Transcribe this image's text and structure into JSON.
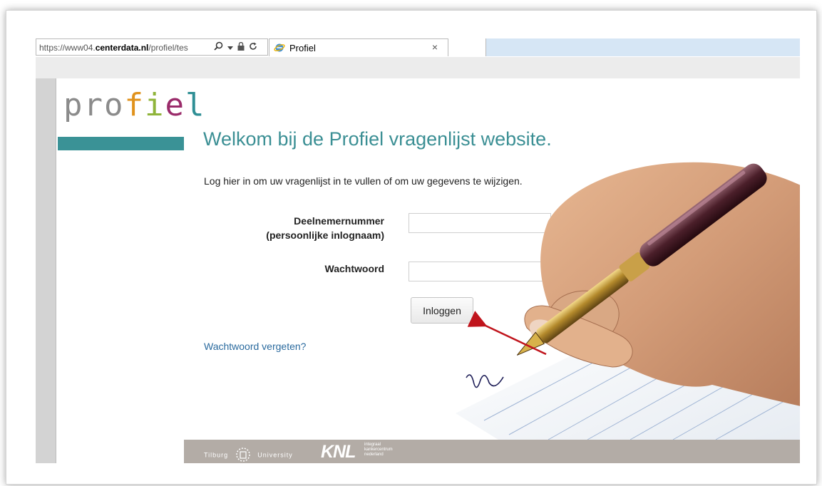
{
  "browser": {
    "url_prefix": "https://www04.",
    "url_domain": "centerdata.nl",
    "url_path": "/profiel/tes",
    "tab_title": "Profiel",
    "tab_close": "×"
  },
  "logo": {
    "pro": "pro",
    "f": "f",
    "i": "i",
    "e": "e",
    "l": "l"
  },
  "page": {
    "heading": "Welkom bij de Profiel vragenlijst website.",
    "intro": "Log hier in om uw vragenlijst in te vullen of om uw gegevens te wijzigen.",
    "username_label": "Deelnemernummer",
    "username_sublabel": "(persoonlijke inlognaam)",
    "password_label": "Wachtwoord",
    "username_value": "",
    "password_value": "",
    "login_button": "Inloggen",
    "forgot_link": "Wachtwoord vergeten?"
  },
  "footer": {
    "tilburg_left": "Tilburg",
    "tilburg_right": "University",
    "knl": "KNL",
    "knl_sub_1": "integraal",
    "knl_sub_2": "kankercentrum",
    "knl_sub_3": "nederland"
  },
  "colors": {
    "accent_teal": "#3a9296",
    "link_blue": "#2a6a9e",
    "arrow_red": "#c0141c"
  },
  "icons": [
    "search-icon",
    "dropdown-icon",
    "lock-icon",
    "refresh-icon",
    "ie-icon",
    "close-icon"
  ]
}
